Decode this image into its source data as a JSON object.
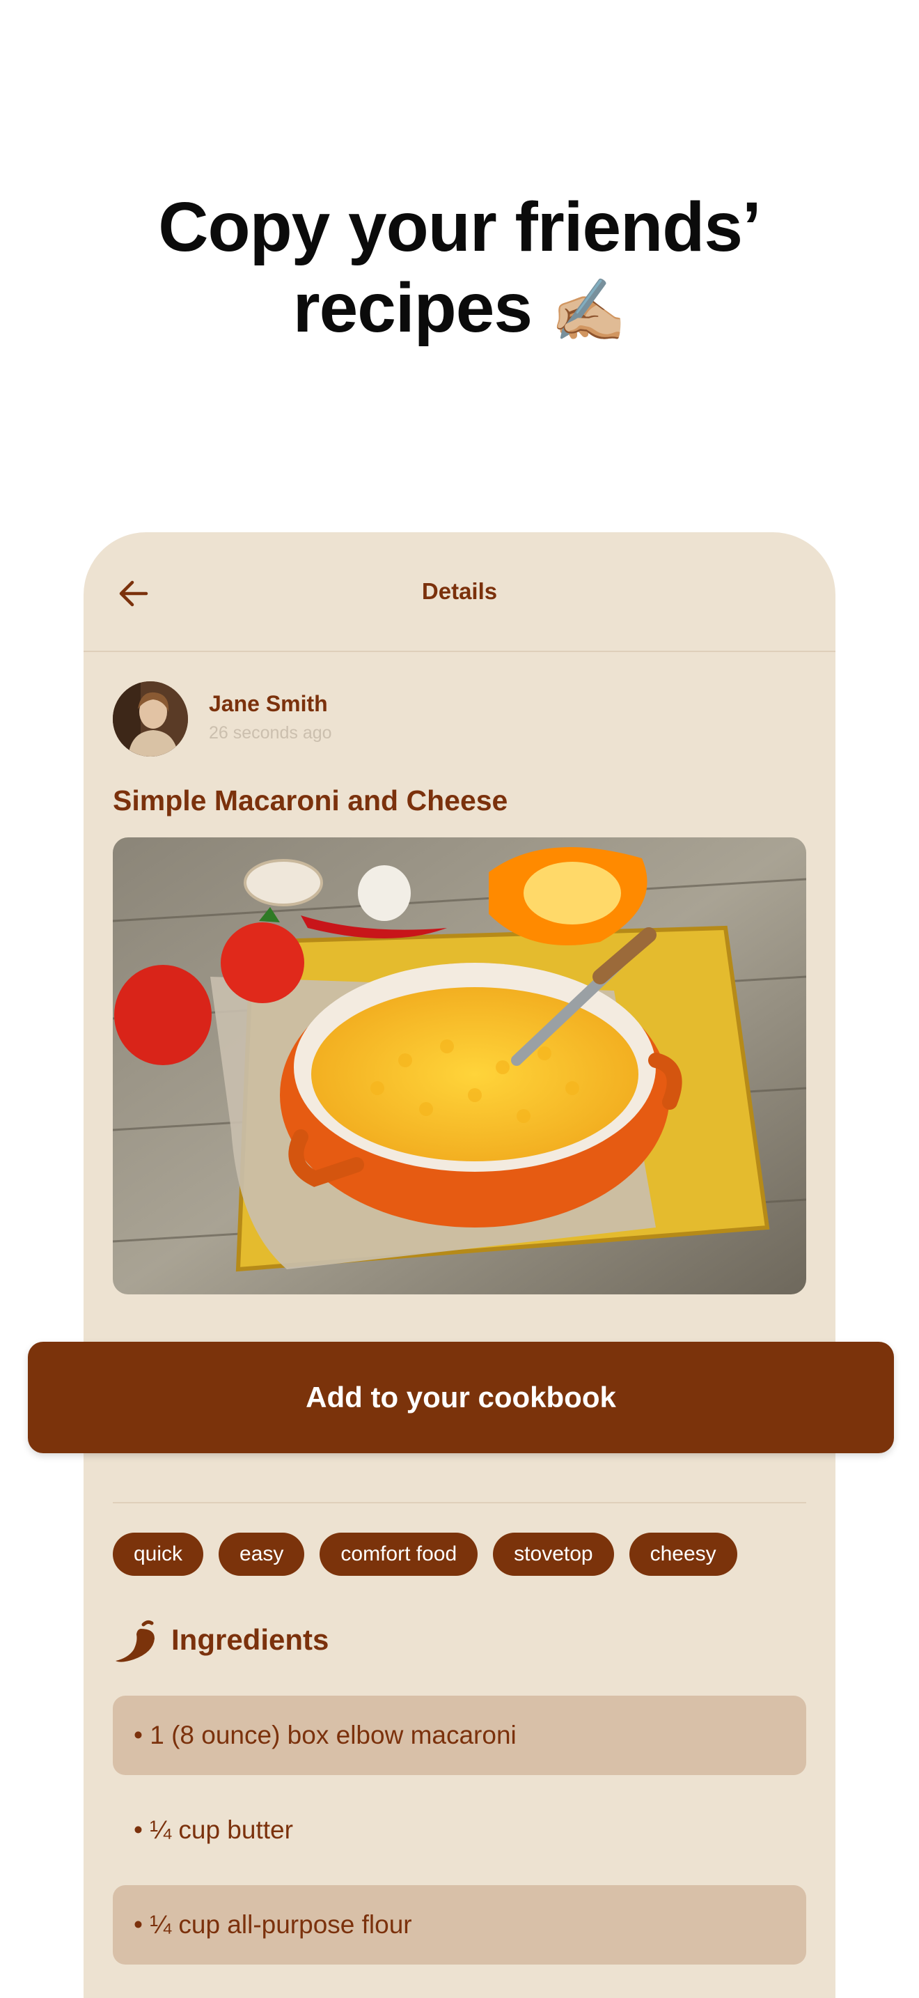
{
  "headline": {
    "line1": "Copy your friends’",
    "line2": "recipes",
    "emoji": "✍🏼"
  },
  "nav": {
    "title": "Details",
    "back_icon": "arrow-left-icon"
  },
  "author": {
    "name": "Jane Smith",
    "time": "26 seconds ago"
  },
  "recipe": {
    "title": "Simple Macaroni and Cheese"
  },
  "cta": {
    "label": "Add to your cookbook"
  },
  "tags": [
    "quick",
    "easy",
    "comfort food",
    "stovetop",
    "cheesy"
  ],
  "ingredients": {
    "title": "Ingredients",
    "icon": "chili-pepper-icon",
    "items": [
      "• 1 (8 ounce) box elbow macaroni",
      "• ¼ cup butter",
      "• ¼ cup all-purpose flour"
    ]
  },
  "colors": {
    "accent": "#7b330b",
    "panel": "#ede2d1",
    "row_shade": "#d8c0a8"
  }
}
